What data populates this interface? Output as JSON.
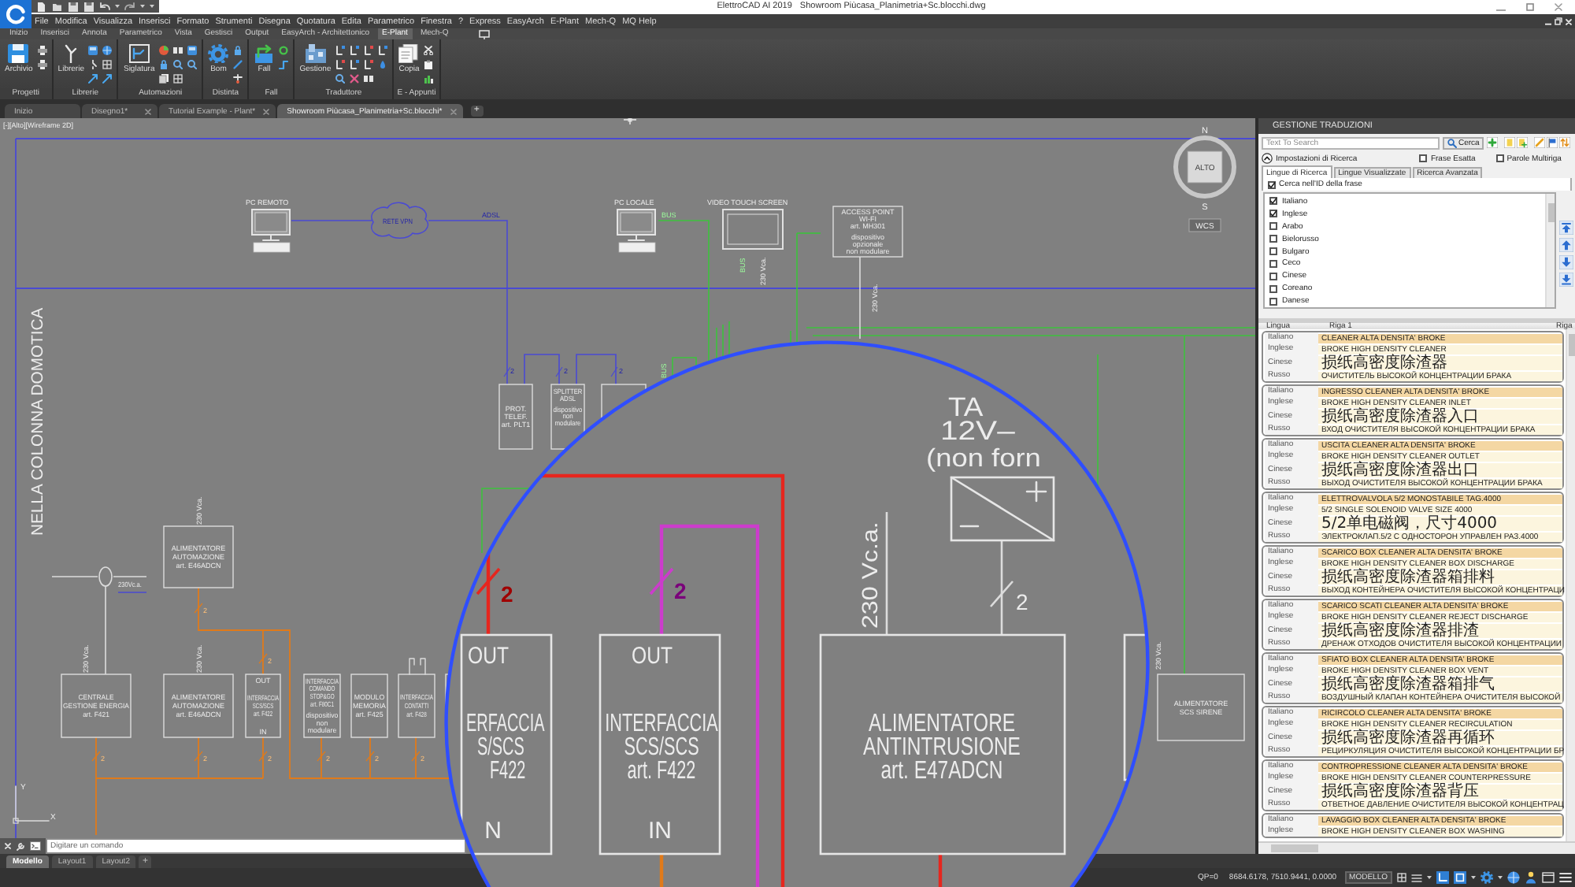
{
  "window": {
    "app_title": "ElettroCAD AI 2019",
    "document_title": "Showroom Piùcasa_Planimetria+Sc.blocchi.dwg"
  },
  "menu": [
    "File",
    "Modifica",
    "Visualizza",
    "Inserisci",
    "Formato",
    "Strumenti",
    "Disegna",
    "Quotatura",
    "Edita",
    "Parametrico",
    "Finestra",
    "?",
    "Express",
    "EasyArch",
    "E-Plant",
    "Mech-Q",
    "MQ Help"
  ],
  "ribbon_tabs": [
    {
      "label": "Inizio",
      "selected": false
    },
    {
      "label": "Inserisci",
      "selected": false
    },
    {
      "label": "Annota",
      "selected": false
    },
    {
      "label": "Parametrico",
      "selected": false
    },
    {
      "label": "Vista",
      "selected": false
    },
    {
      "label": "Gestisci",
      "selected": false
    },
    {
      "label": "Output",
      "selected": false
    },
    {
      "label": "EasyArch - Architettonico",
      "selected": false
    },
    {
      "label": "E-Plant",
      "selected": true
    },
    {
      "label": "Mech-Q",
      "selected": false
    }
  ],
  "ribbon_groups": [
    {
      "title": "Progetti",
      "button": "Archivio"
    },
    {
      "title": "Librerie",
      "button": "Librerie"
    },
    {
      "title": "Automazioni",
      "button": "Siglatura"
    },
    {
      "title": "Distinta",
      "button": "Bom"
    },
    {
      "title": "Fall",
      "button": "Fall"
    },
    {
      "title": "Traduttore",
      "button": "Gestione"
    },
    {
      "title": "E - Appunti",
      "button": "Copia"
    }
  ],
  "document_tabs": [
    {
      "label": "Inizio",
      "selected": false,
      "closable": false
    },
    {
      "label": "Disegno1*",
      "selected": false,
      "closable": true
    },
    {
      "label": "Tutorial Example - Plant*",
      "selected": false,
      "closable": true
    },
    {
      "label": "Showroom Piùcasa_Planimetria+Sc.blocchi*",
      "selected": true,
      "closable": true
    }
  ],
  "new_tab_button": "+",
  "viewport": {
    "label": "[-][Alto][Wireframe 2D]",
    "viewcube": {
      "north": "N",
      "top": "ALTO",
      "south": "S",
      "ucs": "WCS"
    },
    "ucs_icon": {
      "x": "X",
      "y": "Y"
    },
    "labels": [
      "PC REMOTO",
      "RETE VPN",
      "ADSL",
      "PC LOCALE",
      "BUS",
      "VIDEO TOUCH SCREEN",
      "BUS",
      "230 Vca.",
      "230 Vca.",
      "NELLA COLONNA DOMOTICA",
      "2",
      "2",
      "2",
      "230 Vca.",
      "230 Vca.",
      "230 Vca.",
      "230 Vca.",
      "230Vc.a.",
      "2",
      "2",
      "2",
      "2",
      "2",
      "2",
      "2",
      "2",
      "BUS"
    ],
    "devices": [
      {
        "lines": [
          "ACCESS POINT",
          "WI-FI",
          "art. MH301"
        ],
        "note": [
          "dispositivo",
          "opzionale",
          "non modulare"
        ]
      },
      {
        "lines": [
          "PROT.",
          "TELEF.",
          "art. PLT1"
        ]
      },
      {
        "lines": [
          "SPLITTER",
          "ADSL"
        ],
        "note": [
          "dispositivo",
          "non",
          "modulare"
        ]
      },
      {
        "lines": [
          "ALIMENTATORE",
          "AUTOMAZIONE",
          "art. E46ADCN"
        ]
      },
      {
        "lines": [
          "CENTRALE",
          "GESTIONE ENERGIA",
          "art. F421"
        ]
      },
      {
        "lines": [
          "ALIMENTATORE",
          "AUTOMAZIONE",
          "art. E46ADCN"
        ]
      },
      {
        "lines": [
          "INTERFACCIA",
          "SCS/SCS",
          "art. F422"
        ],
        "top_port": "OUT",
        "bottom_port": "IN"
      },
      {
        "lines": [
          "INTERFACCIA",
          "COMANDO",
          "STOP&GO",
          "art. F80C1"
        ],
        "note": [
          "dispositivo",
          "non",
          "modulare"
        ]
      },
      {
        "lines": [
          "MODULO",
          "MEMORIA",
          "art. F425"
        ]
      },
      {
        "lines": [
          "INTERFACCIA",
          "CONTATTI",
          "art. F428"
        ]
      },
      {
        "lines": [
          "ALIMENTATORE",
          "SCS SIRENE"
        ]
      }
    ],
    "magnifier": {
      "labels": [
        "TA",
        "12V–",
        "(non forn",
        "2",
        "2",
        "2",
        "230 Vc.a."
      ],
      "devices": [
        {
          "lines": [
            "ERFACCIA",
            "S/SCS",
            "F422"
          ],
          "top_port": "OUT",
          "bottom_port": "N"
        },
        {
          "lines": [
            "INTERFACCIA",
            "SCS/SCS",
            "art. F422"
          ],
          "top_port": "OUT",
          "bottom_port": "IN"
        },
        {
          "lines": [
            "ALIMENTATORE",
            "ANTINTRUSIONE",
            "art. E47ADCN"
          ]
        }
      ]
    }
  },
  "command_line": {
    "placeholder": "Digitare un comando"
  },
  "layout_tabs": [
    {
      "label": "Modello",
      "selected": true
    },
    {
      "label": "Layout1",
      "selected": false
    },
    {
      "label": "Layout2",
      "selected": false
    }
  ],
  "add_layout_button": "+",
  "status_bar": {
    "qp": "QP=0",
    "coordinates": "8684.6178, 7510.9441, 0.0000",
    "space": "MODELLO"
  },
  "translation_panel": {
    "title": "GESTIONE TRADUZIONI",
    "search": {
      "placeholder": "Text To Search"
    },
    "search_button": "Cerca",
    "settings": {
      "label": "Impostazioni di Ricerca",
      "expanded": true
    },
    "options": [
      {
        "label": "Frase Esatta",
        "checked": false
      },
      {
        "label": "Parole Multiriga",
        "checked": false
      }
    ],
    "tabs": [
      {
        "label": "Lingue di Ricerca",
        "selected": true
      },
      {
        "label": "Lingue Visualizzate",
        "selected": false
      },
      {
        "label": "Ricerca Avanzata",
        "selected": false
      }
    ],
    "search_id": {
      "label": "Cerca nell'ID della frase",
      "checked": true
    },
    "languages": [
      {
        "label": "Italiano",
        "checked": true
      },
      {
        "label": "Inglese",
        "checked": true
      },
      {
        "label": "Arabo",
        "checked": false
      },
      {
        "label": "Bielorusso",
        "checked": false
      },
      {
        "label": "Bulgaro",
        "checked": false
      },
      {
        "label": "Ceco",
        "checked": false
      },
      {
        "label": "Cinese",
        "checked": false
      },
      {
        "label": "Coreano",
        "checked": false
      },
      {
        "label": "Danese",
        "checked": false
      }
    ],
    "columns": [
      "Lingua",
      "Riga 1",
      "Riga"
    ],
    "records": [
      {
        "rows": [
          {
            "language": "Italiano",
            "kind": "source",
            "text": "CLEANER ALTA DENSITA' BROKE"
          },
          {
            "language": "Inglese",
            "kind": "translation",
            "text": "BROKE HIGH DENSITY CLEANER"
          },
          {
            "language": "Cinese",
            "kind": "translation",
            "text": "损纸高密度除渣器"
          },
          {
            "language": "Russo",
            "kind": "translation",
            "text": "ОЧИСТИТЕЛЬ ВЫСОКОЙ КОНЦЕНТРАЦИИ БРАКА"
          }
        ]
      },
      {
        "rows": [
          {
            "language": "Italiano",
            "kind": "source",
            "text": "INGRESSO CLEANER ALTA DENSITA' BROKE"
          },
          {
            "language": "Inglese",
            "kind": "translation",
            "text": "BROKE HIGH DENSITY CLEANER INLET"
          },
          {
            "language": "Cinese",
            "kind": "translation",
            "text": "损纸高密度除渣器入口"
          },
          {
            "language": "Russo",
            "kind": "translation",
            "text": "ВХОД ОЧИСТИТЕЛЯ ВЫСОКОЙ КОНЦЕНТРАЦИИ БРАКА"
          }
        ]
      },
      {
        "rows": [
          {
            "language": "Italiano",
            "kind": "source",
            "text": "USCITA CLEANER ALTA DENSITA' BROKE"
          },
          {
            "language": "Inglese",
            "kind": "translation",
            "text": "BROKE HIGH DENSITY CLEANER OUTLET"
          },
          {
            "language": "Cinese",
            "kind": "translation",
            "text": "损纸高密度除渣器出口"
          },
          {
            "language": "Russo",
            "kind": "translation",
            "text": "ВЫХОД ОЧИСТИТЕЛЯ ВЫСОКОЙ КОНЦЕНТРАЦИИ БРАКА"
          }
        ]
      },
      {
        "rows": [
          {
            "language": "Italiano",
            "kind": "source",
            "text": "ELETTROVALVOLA 5/2 MONOSTABILE TAG.4000"
          },
          {
            "language": "Inglese",
            "kind": "translation",
            "text": "5/2 SINGLE SOLENOID VALVE SIZE 4000"
          },
          {
            "language": "Cinese",
            "kind": "translation",
            "text": "5/2单电磁阀，尺寸4000"
          },
          {
            "language": "Russo",
            "kind": "translation",
            "text": "ЭЛЕКТРОКЛАП.5/2 С ОДНОСТОРОН УПРАВЛЕН РАЗ.4000"
          }
        ]
      },
      {
        "rows": [
          {
            "language": "Italiano",
            "kind": "source",
            "text": "SCARICO BOX CLEANER ALTA DENSITA' BROKE"
          },
          {
            "language": "Inglese",
            "kind": "translation",
            "text": "BROKE HIGH DENSITY CLEANER BOX DISCHARGE"
          },
          {
            "language": "Cinese",
            "kind": "translation",
            "text": "损纸高密度除渣器箱排料"
          },
          {
            "language": "Russo",
            "kind": "translation",
            "text": "ВЫХОД КОНТЕЙНЕРА ОЧИСТИТЕЛЯ ВЫСОКОЙ КОНЦЕНТРАЦИ"
          }
        ]
      },
      {
        "rows": [
          {
            "language": "Italiano",
            "kind": "source",
            "text": "SCARICO SCATI CLEANER ALTA DENSITA' BROKE"
          },
          {
            "language": "Inglese",
            "kind": "translation",
            "text": "BROKE HIGH DENSITY CLEANER REJECT DISCHARGE"
          },
          {
            "language": "Cinese",
            "kind": "translation",
            "text": "损纸高密度除渣器排渣"
          },
          {
            "language": "Russo",
            "kind": "translation",
            "text": "ДРЕНАЖ ОТХОДОВ ОЧИСТИТЕЛЯ ВЫСОКОЙ КОНЦЕНТРАЦИИ"
          }
        ]
      },
      {
        "rows": [
          {
            "language": "Italiano",
            "kind": "source",
            "text": "SFIATO BOX CLEANER ALTA DENSITA' BROKE"
          },
          {
            "language": "Inglese",
            "kind": "translation",
            "text": "BROKE HIGH DENSITY CLEANER BOX VENT"
          },
          {
            "language": "Cinese",
            "kind": "translation",
            "text": "损纸高密度除渣器箱排气"
          },
          {
            "language": "Russo",
            "kind": "translation",
            "text": "ВОЗДУШНЫЙ КЛАПАН КОНТЕЙНЕРА ОЧИСТИТЕЛЯ ВЫСОКОЙ"
          }
        ]
      },
      {
        "rows": [
          {
            "language": "Italiano",
            "kind": "source",
            "text": "RICIRCOLO CLEANER ALTA DENSITA' BROKE"
          },
          {
            "language": "Inglese",
            "kind": "translation",
            "text": "BROKE HIGH DENSITY CLEANER RECIRCULATION"
          },
          {
            "language": "Cinese",
            "kind": "translation",
            "text": "损纸高密度除渣器再循环"
          },
          {
            "language": "Russo",
            "kind": "translation",
            "text": "РЕЦИРКУЛЯЦИЯ ОЧИСТИТЕЛЯ ВЫСОКОЙ КОНЦЕНТРАЦИИ БР"
          }
        ]
      },
      {
        "rows": [
          {
            "language": "Italiano",
            "kind": "source",
            "text": "CONTROPRESSIONE CLEANER ALTA DENSITA' BROKE"
          },
          {
            "language": "Inglese",
            "kind": "translation",
            "text": "BROKE HIGH DENSITY CLEANER COUNTERPRESSURE"
          },
          {
            "language": "Cinese",
            "kind": "translation",
            "text": "损纸高密度除渣器背压"
          },
          {
            "language": "Russo",
            "kind": "translation",
            "text": "ОТВЕТНОЕ ДАВЛЕНИЕ ОЧИСТИТЕЛЯ ВЫСОКОЙ КОНЦЕНТРАЦ"
          }
        ]
      },
      {
        "rows": [
          {
            "language": "Italiano",
            "kind": "source",
            "text": "LAVAGGIO BOX CLEANER ALTA DENSITA' BROKE"
          },
          {
            "language": "Inglese",
            "kind": "translation",
            "text": "BROKE HIGH DENSITY CLEANER BOX WASHING"
          }
        ]
      }
    ]
  }
}
